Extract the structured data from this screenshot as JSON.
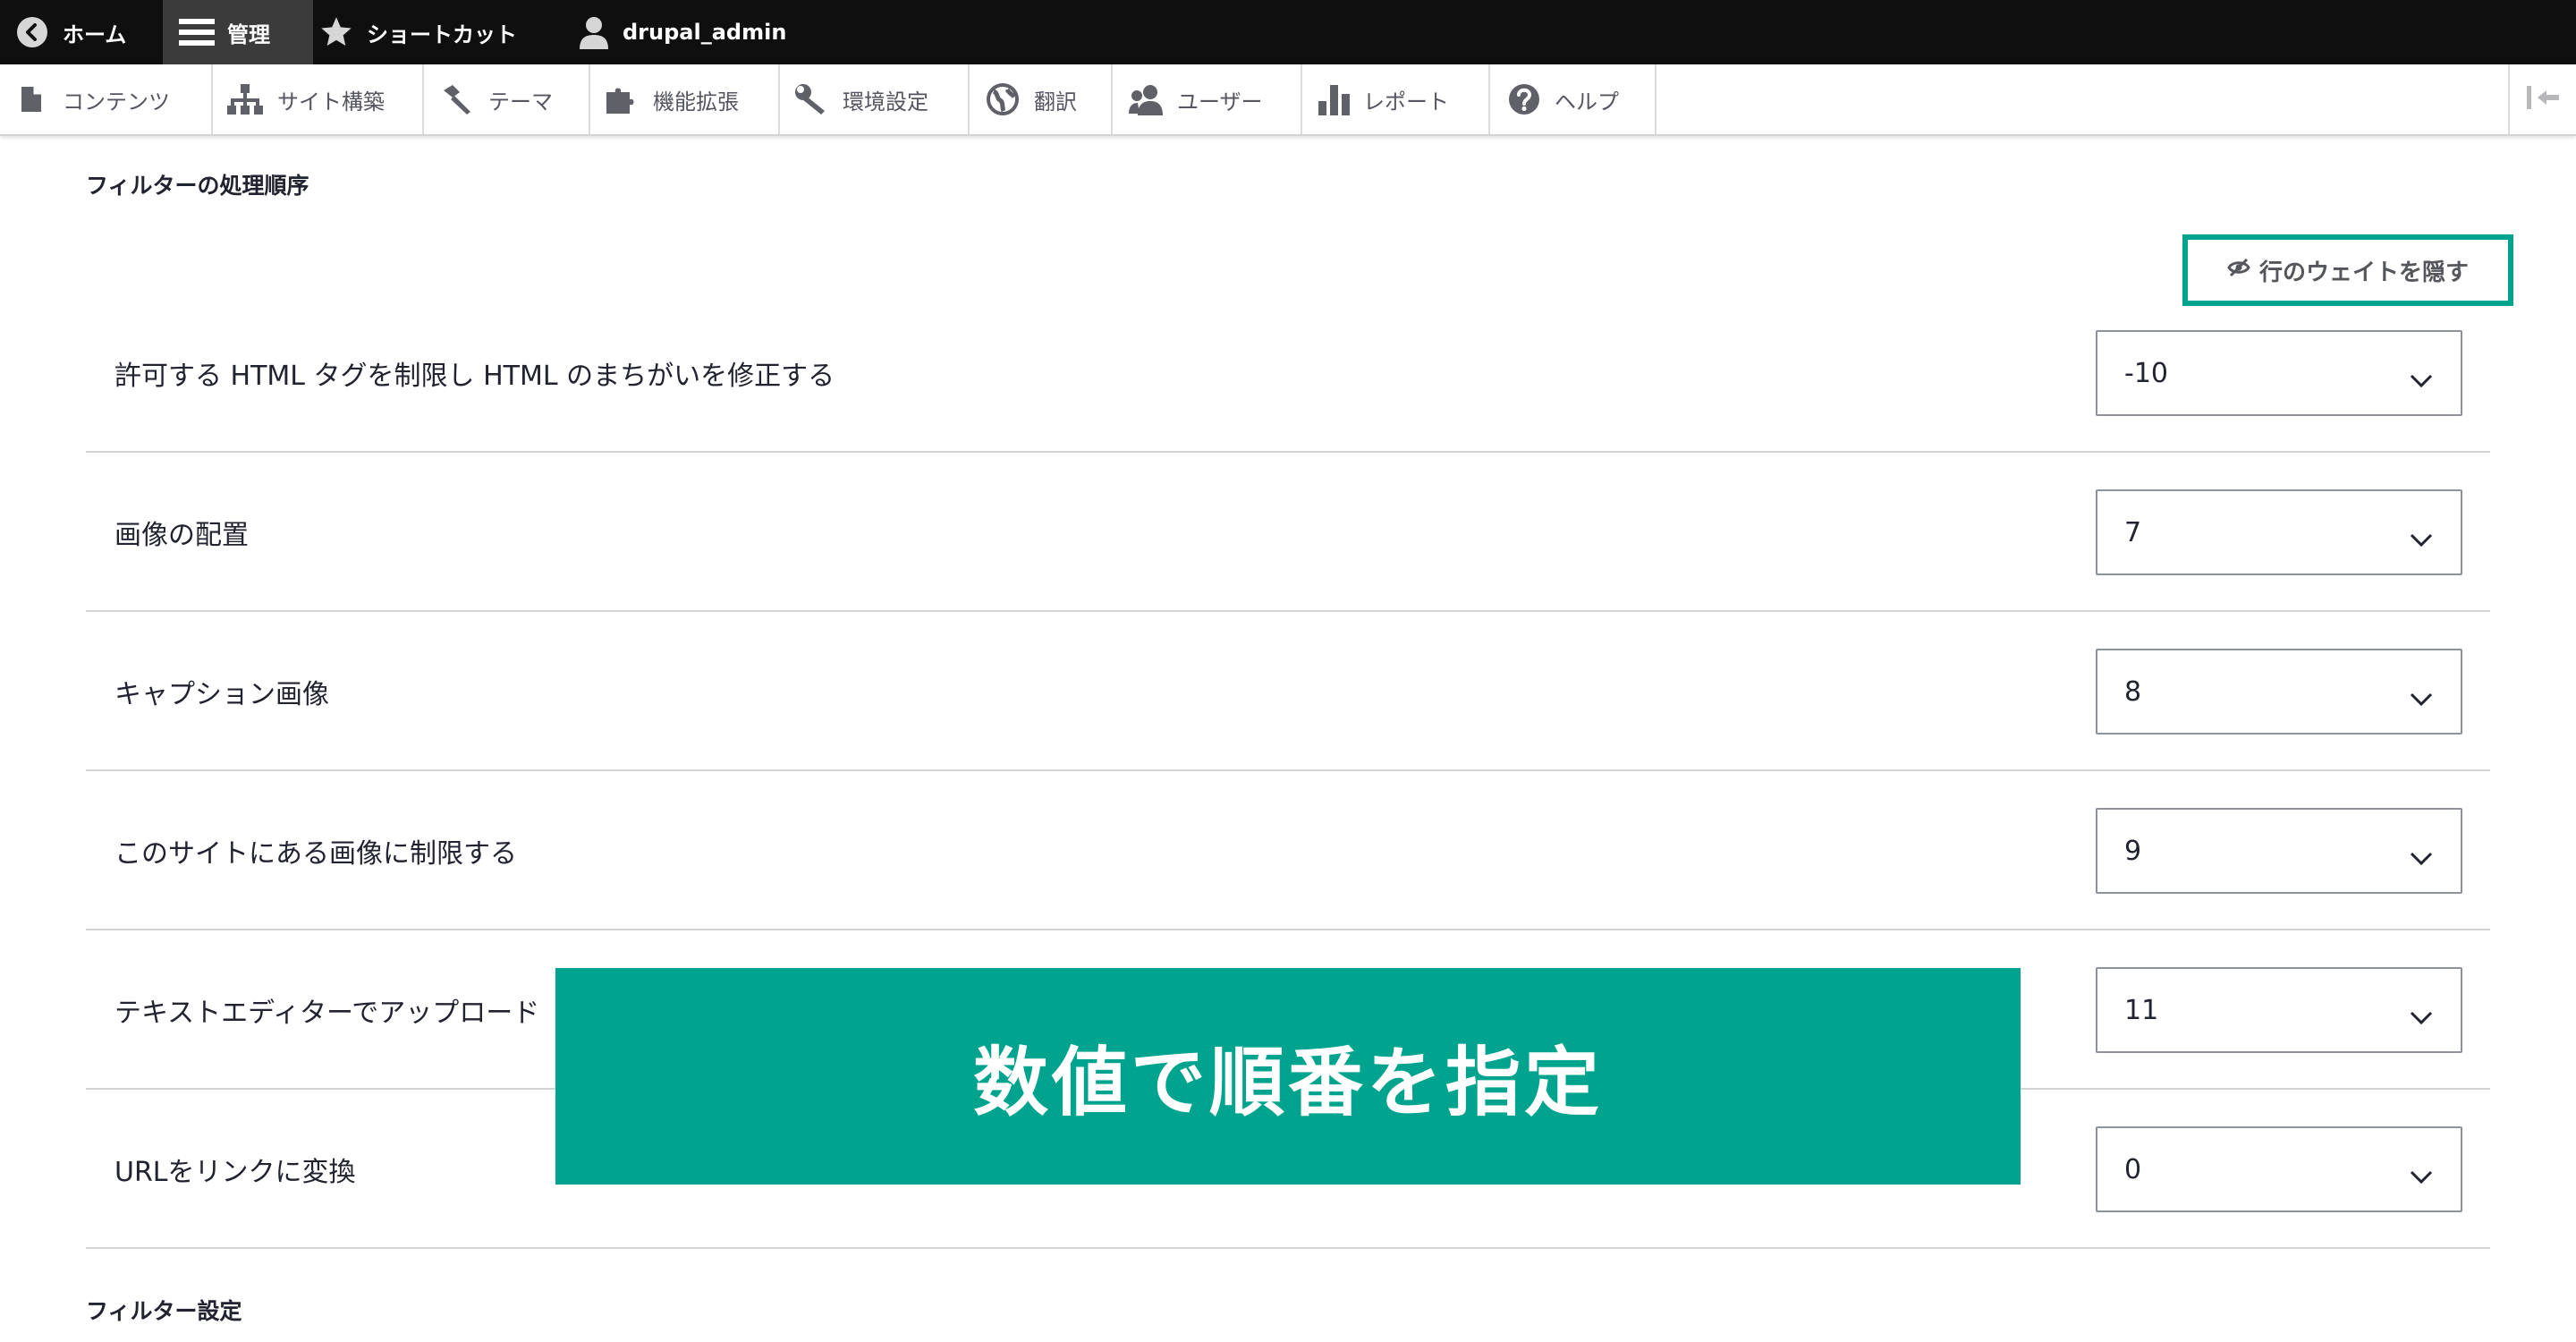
{
  "toolbar": {
    "home": "ホーム",
    "manage": "管理",
    "shortcuts": "ショートカット",
    "user": "drupal_admin"
  },
  "tray": {
    "items": [
      "コンテンツ",
      "サイト構築",
      "テーマ",
      "機能拡張",
      "環境設定",
      "翻訳",
      "ユーザー",
      "レポート",
      "ヘルプ"
    ]
  },
  "processing_order": {
    "title": "フィルターの処理順序",
    "toggle_label": "行のウェイトを隠す",
    "filters": [
      {
        "label": "許可する HTML タグを制限し HTML のまちがいを修正する",
        "weight": "-10"
      },
      {
        "label": "画像の配置",
        "weight": "7"
      },
      {
        "label": "キャプション画像",
        "weight": "8"
      },
      {
        "label": "このサイトにある画像に制限する",
        "weight": "9"
      },
      {
        "label": "テキストエディターでアップロード",
        "weight": "11"
      },
      {
        "label": "URLをリンクに変換",
        "weight": "0"
      }
    ]
  },
  "filter_settings": {
    "title": "フィルター設定"
  },
  "banner": {
    "text": "数値で順番を指定"
  },
  "colors": {
    "accent": "#00a48e",
    "toolbar_bg": "#0f0f0f",
    "toolbar_active": "#3b3b3b"
  }
}
